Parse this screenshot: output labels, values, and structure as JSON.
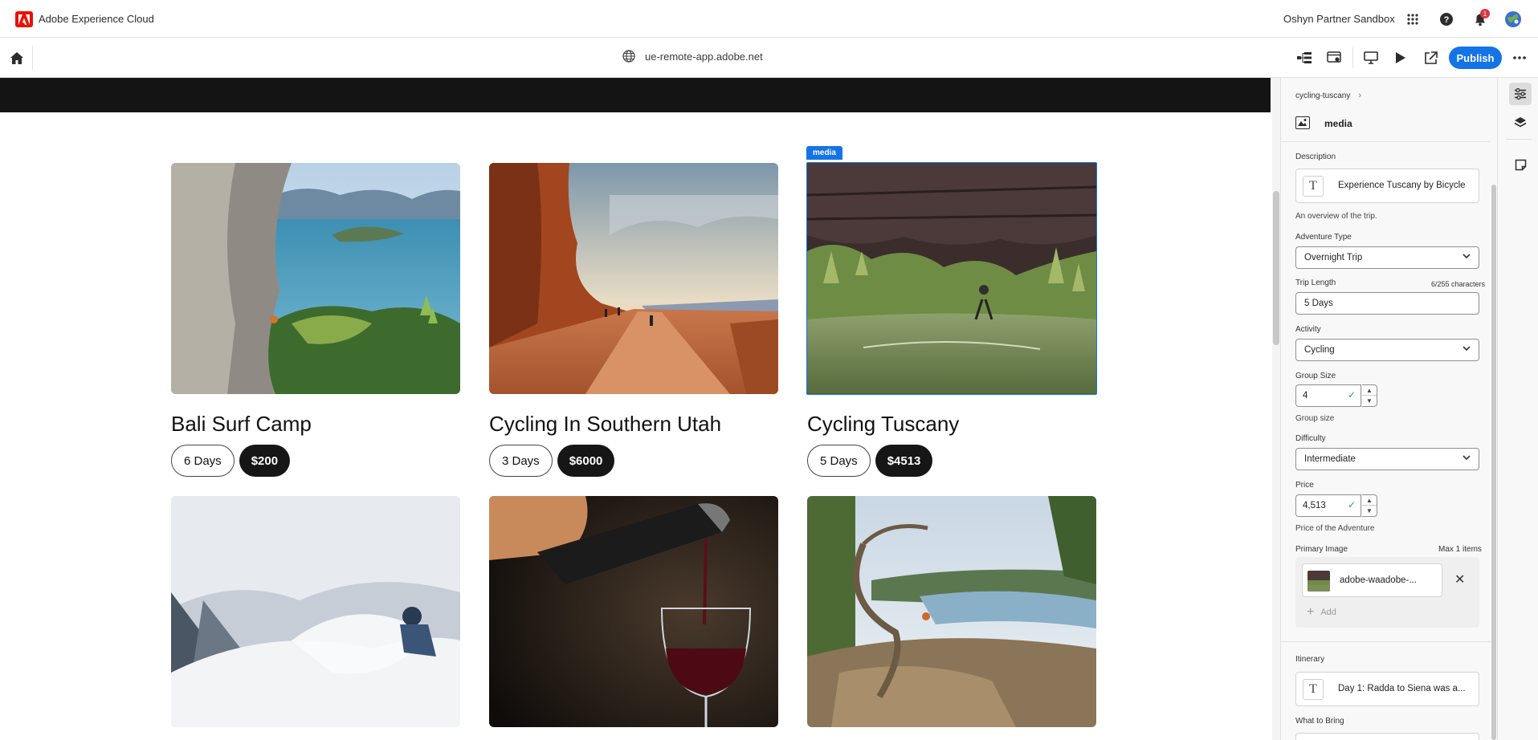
{
  "app": {
    "title": "Adobe Experience Cloud",
    "org": "Oshyn Partner Sandbox",
    "notification_count": "1"
  },
  "urlbar": {
    "url": "ue-remote-app.adobe.net",
    "publish_label": "Publish"
  },
  "cards": [
    {
      "title": "Bali Surf Camp",
      "length": "6 Days",
      "price": "$200"
    },
    {
      "title": "Cycling In Southern Utah",
      "length": "3 Days",
      "price": "$6000"
    },
    {
      "title": "Cycling Tuscany",
      "length": "5 Days",
      "price": "$4513"
    }
  ],
  "selection": {
    "tag": "media"
  },
  "panel": {
    "breadcrumb": "cycling-tuscany",
    "component_name": "media",
    "description": {
      "label": "Description",
      "value": "Experience Tuscany by Bicycle",
      "helper": "An overview of the trip."
    },
    "adventure_type": {
      "label": "Adventure Type",
      "value": "Overnight Trip"
    },
    "trip_length": {
      "label": "Trip Length",
      "counter": "6/255 characters",
      "value": "5 Days"
    },
    "activity": {
      "label": "Activity",
      "value": "Cycling"
    },
    "group_size": {
      "label": "Group Size",
      "value": "4",
      "helper": "Group size"
    },
    "difficulty": {
      "label": "Difficulty",
      "value": "Intermediate"
    },
    "price": {
      "label": "Price",
      "value": "4,513",
      "helper": "Price of the Adventure"
    },
    "primary_image": {
      "label": "Primary Image",
      "max": "Max 1 items",
      "asset": "adobe-waadobe-...",
      "add_label": "Add"
    },
    "itinerary": {
      "label": "Itinerary",
      "value": "Day 1: Radda to Siena was a..."
    },
    "what_to_bring": {
      "label": "What to Bring"
    }
  }
}
